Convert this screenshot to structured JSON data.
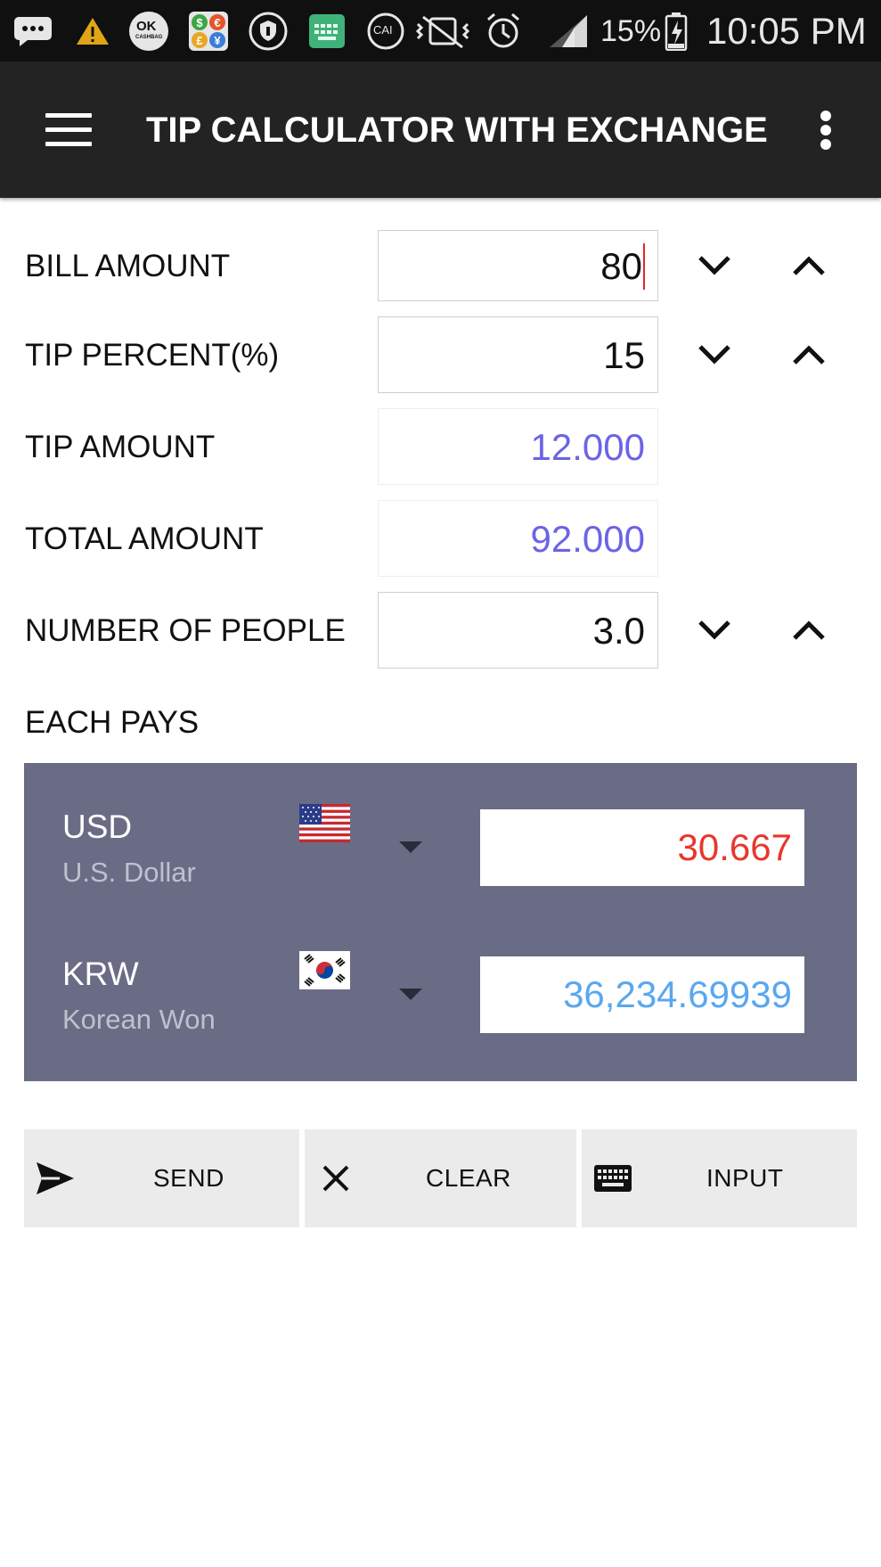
{
  "status_bar": {
    "battery": "15%",
    "time": "10:05 PM",
    "icons": [
      "messenger-icon",
      "warning-icon",
      "ok-cashbag-icon",
      "currency-app-icon",
      "vpn-shield-icon",
      "keyboard-icon",
      "cai-icon",
      "mute-vibrate-icon",
      "alarm-icon",
      "signal-icon",
      "battery-charging-icon"
    ],
    "notif_labels": {
      "ok": "OK",
      "cashbag": "CASHBAG",
      "cai": "CAI"
    }
  },
  "app_bar": {
    "title": "TIP CALCULATOR WITH EXCHANGE…",
    "menu_icon": "hamburger-menu-icon",
    "overflow_icon": "more-vertical-icon"
  },
  "form": {
    "bill_amount": {
      "label": "BILL AMOUNT",
      "value": "80"
    },
    "tip_percent": {
      "label": "TIP PERCENT(%)",
      "value": "15"
    },
    "tip_amount": {
      "label": "TIP AMOUNT",
      "value": "12.000"
    },
    "total_amount": {
      "label": "TOTAL AMOUNT",
      "value": "92.000"
    },
    "number_of_people": {
      "label": "NUMBER OF PEOPLE",
      "value": "3.0"
    },
    "each_pays_label": "EACH PAYS"
  },
  "currencies": [
    {
      "code": "USD",
      "name": "U.S. Dollar",
      "value": "30.667",
      "value_color": "#e8372d"
    },
    {
      "code": "KRW",
      "name": "Korean Won",
      "value": "36,234.69939",
      "value_color": "#5aa7ef"
    }
  ],
  "actions": {
    "send": "SEND",
    "clear": "CLEAR",
    "input": "INPUT"
  },
  "colors": {
    "app_bar": "#232323",
    "panel": "#6a6c85",
    "computed_value": "#6b64e6",
    "button_bg": "#ebebeb"
  }
}
